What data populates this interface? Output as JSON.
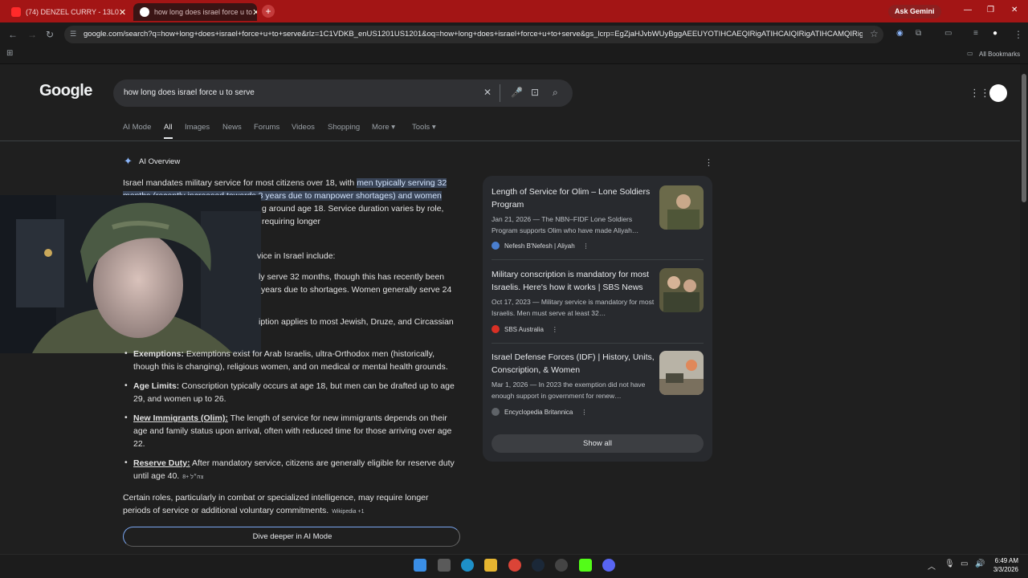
{
  "browser": {
    "tabs": [
      {
        "label": "(74) DENZEL CURRY - 13L0",
        "close": "✕"
      },
      {
        "label": "how long does israel force u to",
        "close": "✕"
      }
    ],
    "new_tab": "+",
    "ask_gemini": "Ask Gemini",
    "url": "google.com/search?q=how+long+does+israel+force+u+to+serve&rlz=1C1VDKB_enUS1201US1201&oq=how+long+does+israel+force+u+to+serve&gs_lcrp=EgZjaHJvbWUyBggAEEUYOTIHCAEQIRigATIHCAIQIRigATIHCAMQIRigATIH...",
    "all_bookmarks": "All Bookmarks"
  },
  "google": {
    "logo": "Google",
    "query": "how long does israel force u to serve",
    "filters": [
      "AI Mode",
      "All",
      "Images",
      "News",
      "Forums",
      "Videos",
      "Shopping",
      "More ▾",
      "Tools ▾"
    ],
    "active_filter": "All"
  },
  "ai_overview": {
    "heading": "AI Overview",
    "intro_a": "Israel mandates military service for most citizens over 18, with ",
    "intro_hl": "men typically serving 32 months (recently increased towards 3 years due to manpower shortages) and women",
    "intro_b_line3": "g around age 18. Service duration varies by role,",
    "intro_b_line4": "requiring longer",
    "section_intro": "vice in Israel include:",
    "men_frag_1": "ly serve 32 months, though this has recently been",
    "men_frag_2": "years due to shortages. Women generally serve 24",
    "univ_frag": "iption applies to most Jewish, Druze, and Circassian",
    "exemptions_label": "Exemptions:",
    "exemptions_text_1": " Exemptions exist for Arab Israelis, ultra-Orthodox men (historically,",
    "exemptions_text_2": "though this is changing), religious women, and on medical or mental health grounds.",
    "age_label": "Age Limits:",
    "age_text_1": " Conscription typically occurs at age 18, but men can be drafted up to age",
    "age_text_2": "29, and women up to 26.",
    "immig_label": "New Immigrants (Olim):",
    "immig_text_1": " The length of service for new immigrants depends on their",
    "immig_text_2": "age and family status upon arrival, often with reduced time for those arriving over age",
    "immig_text_3": "22.",
    "reserve_label": "Reserve Duty:",
    "reserve_text_1": " After mandatory service, citizens are generally eligible for reserve duty",
    "reserve_text_2": "until age 40.",
    "reserve_chip": "צה״ל +8",
    "closing_1": "Certain roles, particularly in combat or specialized intelligence, may require longer",
    "closing_2": "periods of service or additional voluntary commitments.",
    "closing_chip": "Wikipedia +1",
    "dive_deeper": "Dive deeper in AI Mode"
  },
  "sources": [
    {
      "title": "Length of Service for Olim – Lone Soldiers Program",
      "snippet": "Jan 21, 2026 — The NBN–FIDF Lone Soldiers Program supports Olim who have made Aliyah…",
      "source": "Nefesh B'Nefesh | Aliyah",
      "color": "#4a7fd0"
    },
    {
      "title": "Military conscription is mandatory for most Israelis. Here's how it works | SBS News",
      "snippet": "Oct 17, 2023 — Military service is mandatory for most Israelis. Men must serve at least 32…",
      "source": "SBS Australia",
      "color": "#d93025"
    },
    {
      "title": "Israel Defense Forces (IDF) | History, Units, Conscription, & Women",
      "snippet": "Mar 1, 2026 — In 2023 the exemption did not have enough support in government for renew…",
      "source": "Encyclopedia Britannica",
      "color": "#5f6368"
    }
  ],
  "show_all": "Show all",
  "taskbar": {
    "time": "6:49 AM",
    "date": "3/3/2026"
  }
}
